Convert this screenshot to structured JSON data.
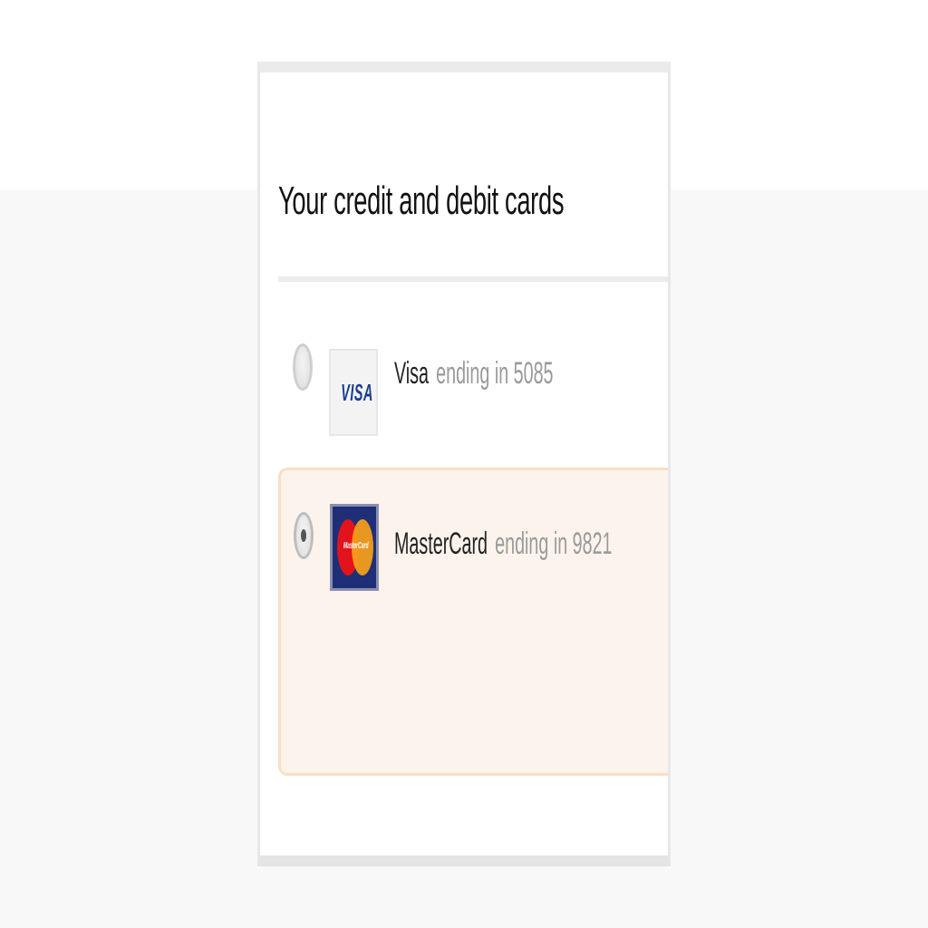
{
  "panel": {
    "title": "Your credit and debit cards"
  },
  "cards": [
    {
      "brand_logo": "visa-logo",
      "logo_text": "VISA",
      "name": "Visa",
      "ending": "ending in 5085",
      "selected": false
    },
    {
      "brand_logo": "mastercard-logo",
      "logo_text": "MasterCard",
      "name": "MasterCard",
      "ending": "ending in 9821",
      "selected": true
    }
  ],
  "colors": {
    "selected_row_bg": "#fcf4ec",
    "selected_row_border": "#f7e1c5",
    "visa_blue": "#1a3d8f",
    "mastercard_red": "#e3131b",
    "mastercard_orange": "#f7a21a"
  }
}
